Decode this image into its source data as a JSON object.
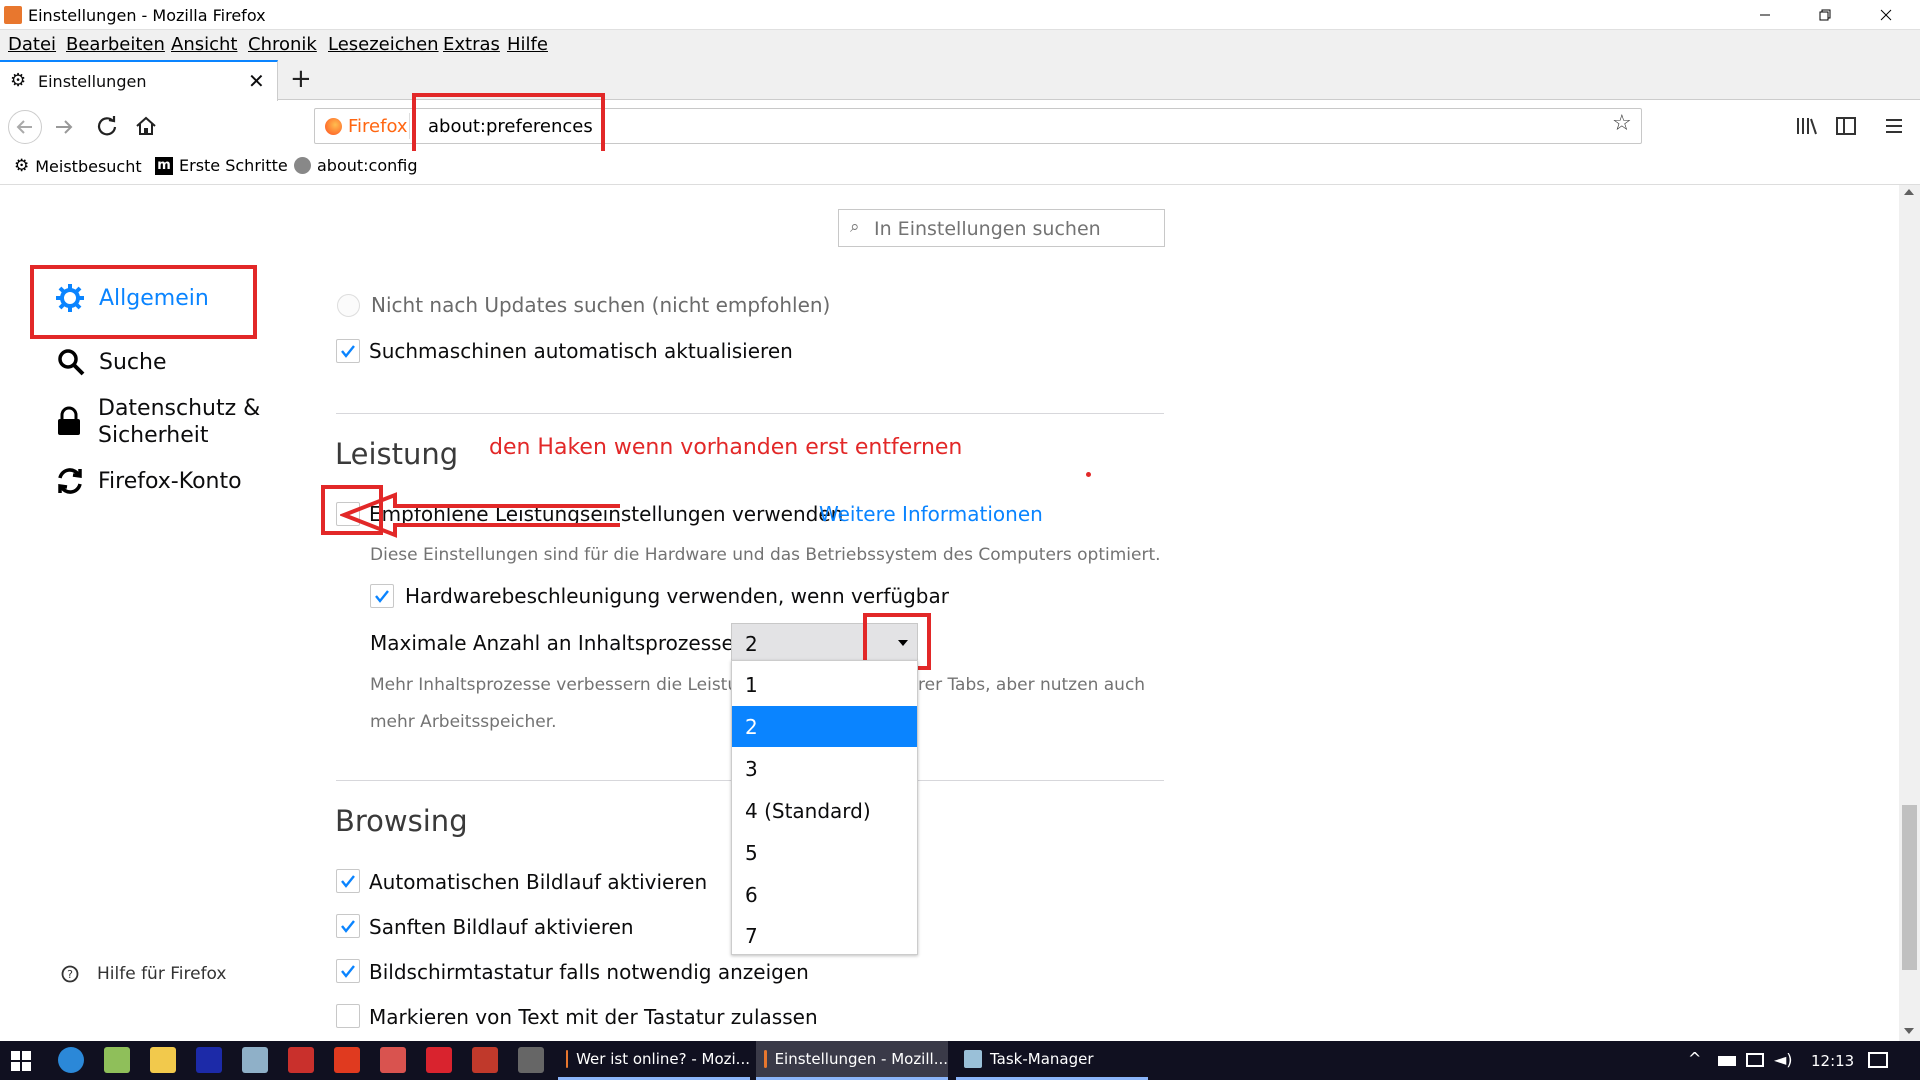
{
  "window": {
    "title": "Einstellungen - Mozilla Firefox"
  },
  "menubar": [
    "Datei",
    "Bearbeiten",
    "Ansicht",
    "Chronik",
    "Lesezeichen",
    "Extras",
    "Hilfe"
  ],
  "tab": {
    "label": "Einstellungen",
    "new_tab_symbol": "+"
  },
  "urlbar": {
    "identity": "Firefox",
    "url": "about:preferences"
  },
  "bookmarks": [
    "Meistbesucht",
    "Erste Schritte",
    "about:config"
  ],
  "search": {
    "placeholder": "In Einstellungen suchen"
  },
  "sidebar": {
    "items": [
      {
        "label": "Allgemein",
        "icon": "gear-icon",
        "selected": true
      },
      {
        "label": "Suche",
        "icon": "search-icon"
      },
      {
        "label": "Datenschutz &",
        "label2": "Sicherheit",
        "icon": "lock-icon"
      },
      {
        "label": "Firefox-Konto",
        "icon": "sync-icon"
      }
    ],
    "help": "Hilfe für Firefox"
  },
  "updates": {
    "no_updates_label": "Nicht nach Updates suchen (nicht empfohlen)",
    "search_engines_label": "Suchmaschinen automatisch aktualisieren",
    "search_engines_checked": true
  },
  "performance": {
    "heading": "Leistung",
    "annotation": "den Haken wenn vorhanden erst entfernen",
    "recommended_label": "Empfohlene Leistungseinstellungen verwenden",
    "recommended_checked": false,
    "more_info": "Weitere Informationen",
    "recommended_desc": "Diese Einstellungen sind für die Hardware und das Betriebssystem des Computers optimiert.",
    "hw_accel_label": "Hardwarebeschleunigung verwenden, wenn verfügbar",
    "hw_accel_checked": true,
    "process_label": "Maximale Anzahl an Inhaltsprozessen",
    "process_value": "2",
    "process_desc_1": "Mehr Inhaltsprozesse verbessern die Leistung",
    "process_desc_1b": "rer Tabs, aber nutzen auch",
    "process_desc_2": "mehr Arbeitsspeicher.",
    "options": [
      "1",
      "2",
      "3",
      "4 (Standard)",
      "5",
      "6",
      "7"
    ],
    "selected_option_index": 1
  },
  "browsing": {
    "heading": "Browsing",
    "items": [
      {
        "label": "Automatischen Bildlauf aktivieren",
        "checked": true
      },
      {
        "label": "Sanften Bildlauf aktivieren",
        "checked": true
      },
      {
        "label": "Bildschirmtastatur falls notwendig anzeigen",
        "checked": true
      },
      {
        "label": "Markieren von Text mit der Tastatur zulassen",
        "checked": false
      }
    ]
  },
  "taskbar": {
    "tasks": [
      "Wer ist online? - Mozi...",
      "Einstellungen - Mozill...",
      "Task-Manager"
    ],
    "time": "12:13"
  },
  "colors": {
    "accent": "#0a84ff",
    "annotation_red": "#e22828",
    "select_bg": "#0a84ff"
  }
}
